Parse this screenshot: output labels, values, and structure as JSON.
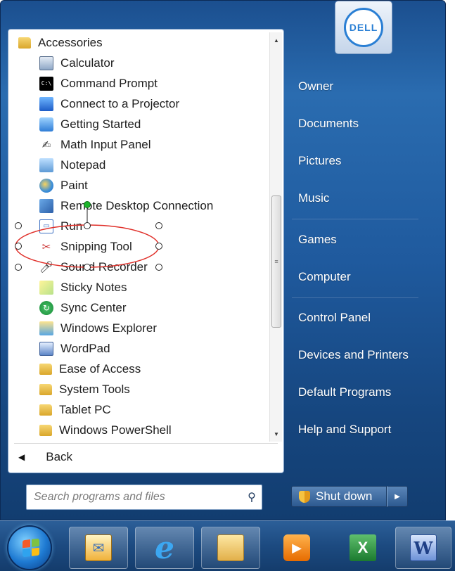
{
  "start_menu": {
    "programs": [
      {
        "label": "Accessories",
        "icon": "folder-icon",
        "level": "top"
      },
      {
        "label": "Calculator",
        "icon": "calculator-icon",
        "level": "sub"
      },
      {
        "label": "Command Prompt",
        "icon": "command-prompt-icon",
        "level": "sub"
      },
      {
        "label": "Connect to a Projector",
        "icon": "projector-icon",
        "level": "sub"
      },
      {
        "label": "Getting Started",
        "icon": "getting-started-icon",
        "level": "sub"
      },
      {
        "label": "Math Input Panel",
        "icon": "math-input-icon",
        "level": "sub"
      },
      {
        "label": "Notepad",
        "icon": "notepad-icon",
        "level": "sub"
      },
      {
        "label": "Paint",
        "icon": "paint-icon",
        "level": "sub"
      },
      {
        "label": "Remote Desktop Connection",
        "icon": "remote-desktop-icon",
        "level": "sub"
      },
      {
        "label": "Run",
        "icon": "run-icon",
        "level": "sub"
      },
      {
        "label": "Snipping Tool",
        "icon": "scissors-icon",
        "level": "sub"
      },
      {
        "label": "Sound Recorder",
        "icon": "microphone-icon",
        "level": "sub"
      },
      {
        "label": "Sticky Notes",
        "icon": "sticky-notes-icon",
        "level": "sub"
      },
      {
        "label": "Sync Center",
        "icon": "sync-icon",
        "level": "sub"
      },
      {
        "label": "Windows Explorer",
        "icon": "explorer-icon",
        "level": "sub"
      },
      {
        "label": "WordPad",
        "icon": "wordpad-icon",
        "level": "sub"
      },
      {
        "label": "Ease of Access",
        "icon": "folder-icon",
        "level": "sub"
      },
      {
        "label": "System Tools",
        "icon": "folder-icon",
        "level": "sub"
      },
      {
        "label": "Tablet PC",
        "icon": "folder-icon",
        "level": "sub"
      },
      {
        "label": "Windows PowerShell",
        "icon": "folder-icon",
        "level": "sub"
      }
    ],
    "back_label": "Back",
    "search_placeholder": "Search programs and files",
    "right_items": {
      "owner": "Owner",
      "documents": "Documents",
      "pictures": "Pictures",
      "music": "Music",
      "games": "Games",
      "computer": "Computer",
      "control_panel": "Control Panel",
      "devices_printers": "Devices and Printers",
      "default_programs": "Default Programs",
      "help_support": "Help and Support"
    },
    "user_picture_logo": "DELL",
    "shutdown_label": "Shut down"
  },
  "taskbar": {
    "start_button": "windows-start-orb",
    "pinned": [
      "mail-icon",
      "internet-explorer-icon",
      "folder-icon",
      "media-player-icon",
      "excel-icon",
      "word-icon"
    ],
    "labels": {
      "ie": "e",
      "word": "W",
      "excel": "X"
    }
  },
  "annotation": {
    "highlight_color": "#e0302a",
    "handle_color": "#1db42b"
  },
  "colors": {
    "start_menu_blue": "#1f5a9e",
    "taskbar_blue": "#1c4a80"
  }
}
